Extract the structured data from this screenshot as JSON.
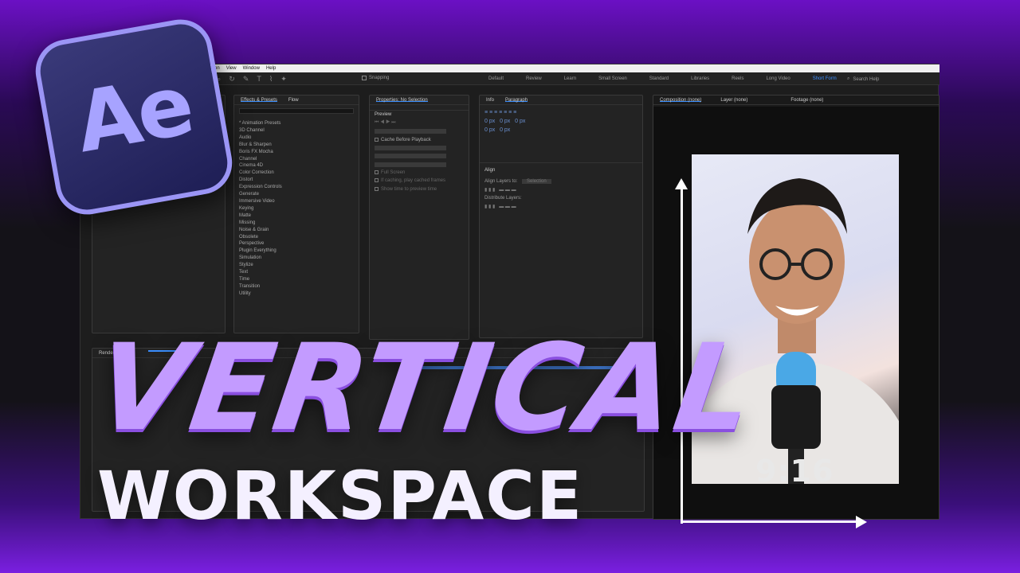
{
  "menu": {
    "items": [
      "Animation",
      "View",
      "Window",
      "Help"
    ]
  },
  "toolbar": {
    "snapping_label": "Snapping",
    "workspaces": [
      "Default",
      "Review",
      "Learn",
      "Small Screen",
      "Standard",
      "Libraries",
      "Reels",
      "Long Video",
      "Short Form"
    ],
    "active_workspace": "Short Form",
    "search_label": "Search Help"
  },
  "effects_panel": {
    "tab_label": "Effects & Presets",
    "tab2_label": "Flow",
    "categories": [
      "* Animation Presets",
      "3D Channel",
      "Audio",
      "Blur & Sharpen",
      "Boris FX Mocha",
      "Channel",
      "Cinema 4D",
      "Color Correction",
      "Distort",
      "Expression Controls",
      "Generate",
      "Immersive Video",
      "Keying",
      "Matte",
      "Missing",
      "Noise & Grain",
      "Obsolete",
      "Perspective",
      "Plugin Everything",
      "Simulation",
      "Stylize",
      "Text",
      "Time",
      "Transition",
      "Utility"
    ]
  },
  "properties_panel": {
    "title": "Properties: No Selection",
    "preview_title": "Preview",
    "cache_label": "Cache Before Playback",
    "full_screen_label": "Full Screen",
    "if_caching_label": "If caching, play cached frames",
    "show_time_label": "Show time to preview time"
  },
  "paragraph_panel": {
    "tab1": "Info",
    "tab2": "Paragraph",
    "px_value": "0 px",
    "align_title": "Align",
    "align_layers_label": "Align Layers to:",
    "align_layers_value": "Selection",
    "distribute_label": "Distribute Layers:"
  },
  "composition_panel": {
    "tab1": "Composition (none)",
    "tab2": "Layer (none)",
    "tab3": "Footage (none)",
    "aspect_ratio": "9:16"
  },
  "timeline": {
    "render_label": "Render"
  },
  "thumbnail": {
    "logo_text": "Ae",
    "headline_line1": "VERTICAL",
    "headline_line2": "WORKSPACE"
  },
  "colors": {
    "accent_blue": "#3b8fff",
    "headline_purple": "#c39bff",
    "background_purple": "#7a1fe0"
  }
}
